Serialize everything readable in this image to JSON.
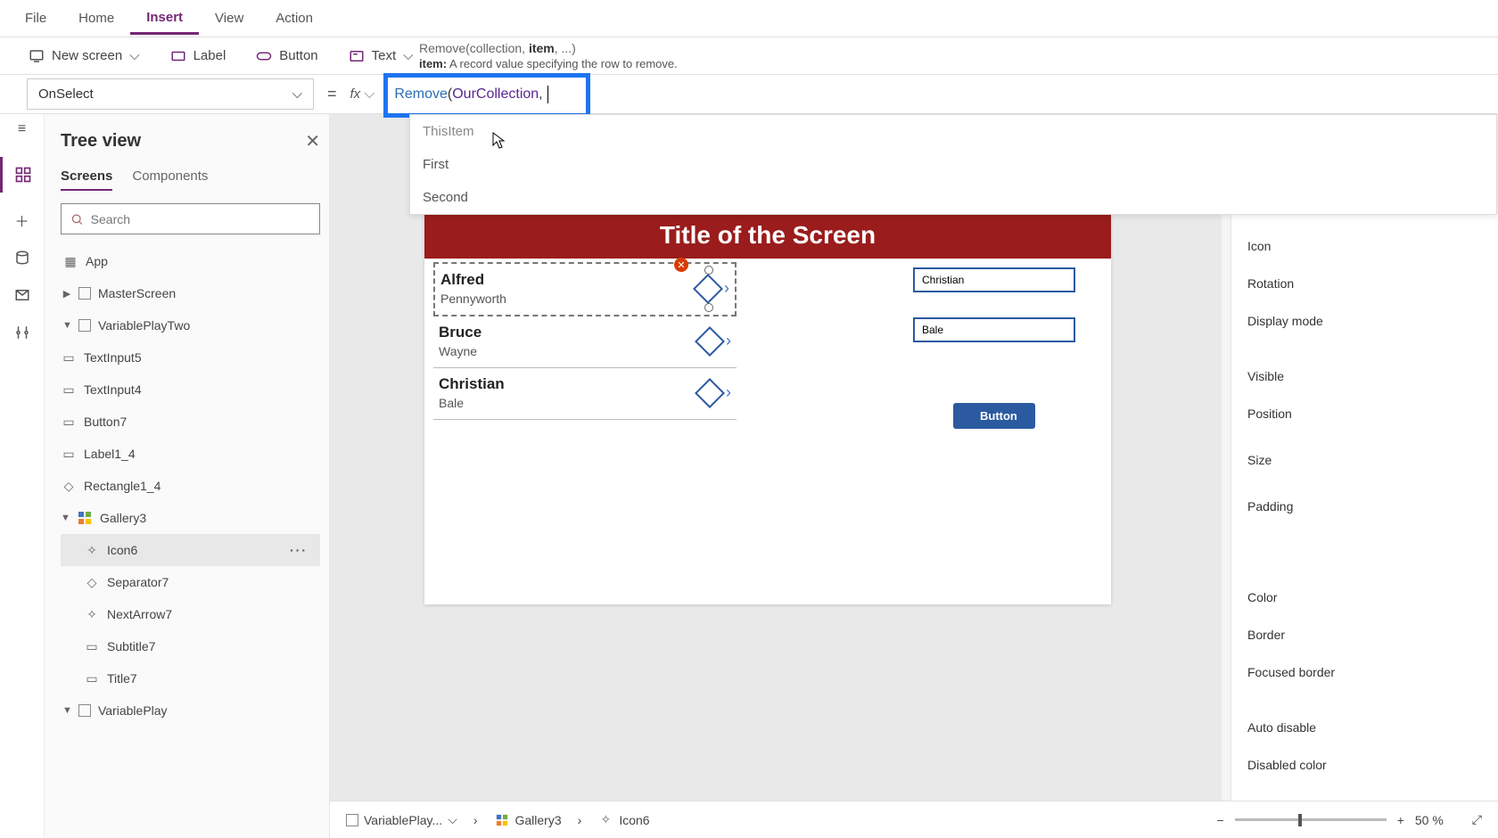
{
  "menu": {
    "items": [
      "File",
      "Home",
      "Insert",
      "View",
      "Action"
    ],
    "active": "Insert"
  },
  "ribbon": {
    "newScreen": "New screen",
    "label": "Label",
    "button": "Button",
    "text": "Text"
  },
  "formulaHint": {
    "signature_pre": "Remove(collection, ",
    "signature_bold": "item",
    "signature_post": ", ...)",
    "param_name": "item:",
    "param_desc": " A record value specifying the row to remove."
  },
  "propertySelector": "OnSelect",
  "formula": {
    "func": "Remove",
    "lparen": "(",
    "coll": "OurCollection",
    "comma": ", "
  },
  "intellisense": [
    "ThisItem",
    "First",
    "Second"
  ],
  "tree": {
    "title": "Tree view",
    "tabs": [
      "Screens",
      "Components"
    ],
    "searchPlaceholder": "Search",
    "nodes": {
      "app": "App",
      "master": "MasterScreen",
      "varPlayTwo": "VariablePlayTwo",
      "textInput5": "TextInput5",
      "textInput4": "TextInput4",
      "button7": "Button7",
      "label1_4": "Label1_4",
      "rectangle1_4": "Rectangle1_4",
      "gallery3": "Gallery3",
      "icon6": "Icon6",
      "separator7": "Separator7",
      "nextArrow7": "NextArrow7",
      "subtitle7": "Subtitle7",
      "title7": "Title7",
      "varPlay": "VariablePlay"
    }
  },
  "canvas": {
    "screenTitle": "Title of the Screen",
    "gallery": [
      {
        "name": "Alfred",
        "surname": "Pennyworth"
      },
      {
        "name": "Bruce",
        "surname": "Wayne"
      },
      {
        "name": "Christian",
        "surname": "Bale"
      }
    ],
    "input1": "Christian",
    "input2": "Bale",
    "buttonLabel": "Button"
  },
  "props": {
    "icon": "Icon",
    "rotation": "Rotation",
    "displayMode": "Display mode",
    "visible": "Visible",
    "position": "Position",
    "size": "Size",
    "padding": "Padding",
    "color": "Color",
    "border": "Border",
    "focusedBorder": "Focused border",
    "autoDisable": "Auto disable",
    "disabledColor": "Disabled color"
  },
  "statusbar": {
    "crumb1": "VariablePlay...",
    "crumb2": "Gallery3",
    "crumb3": "Icon6",
    "zoom": "50  %"
  }
}
